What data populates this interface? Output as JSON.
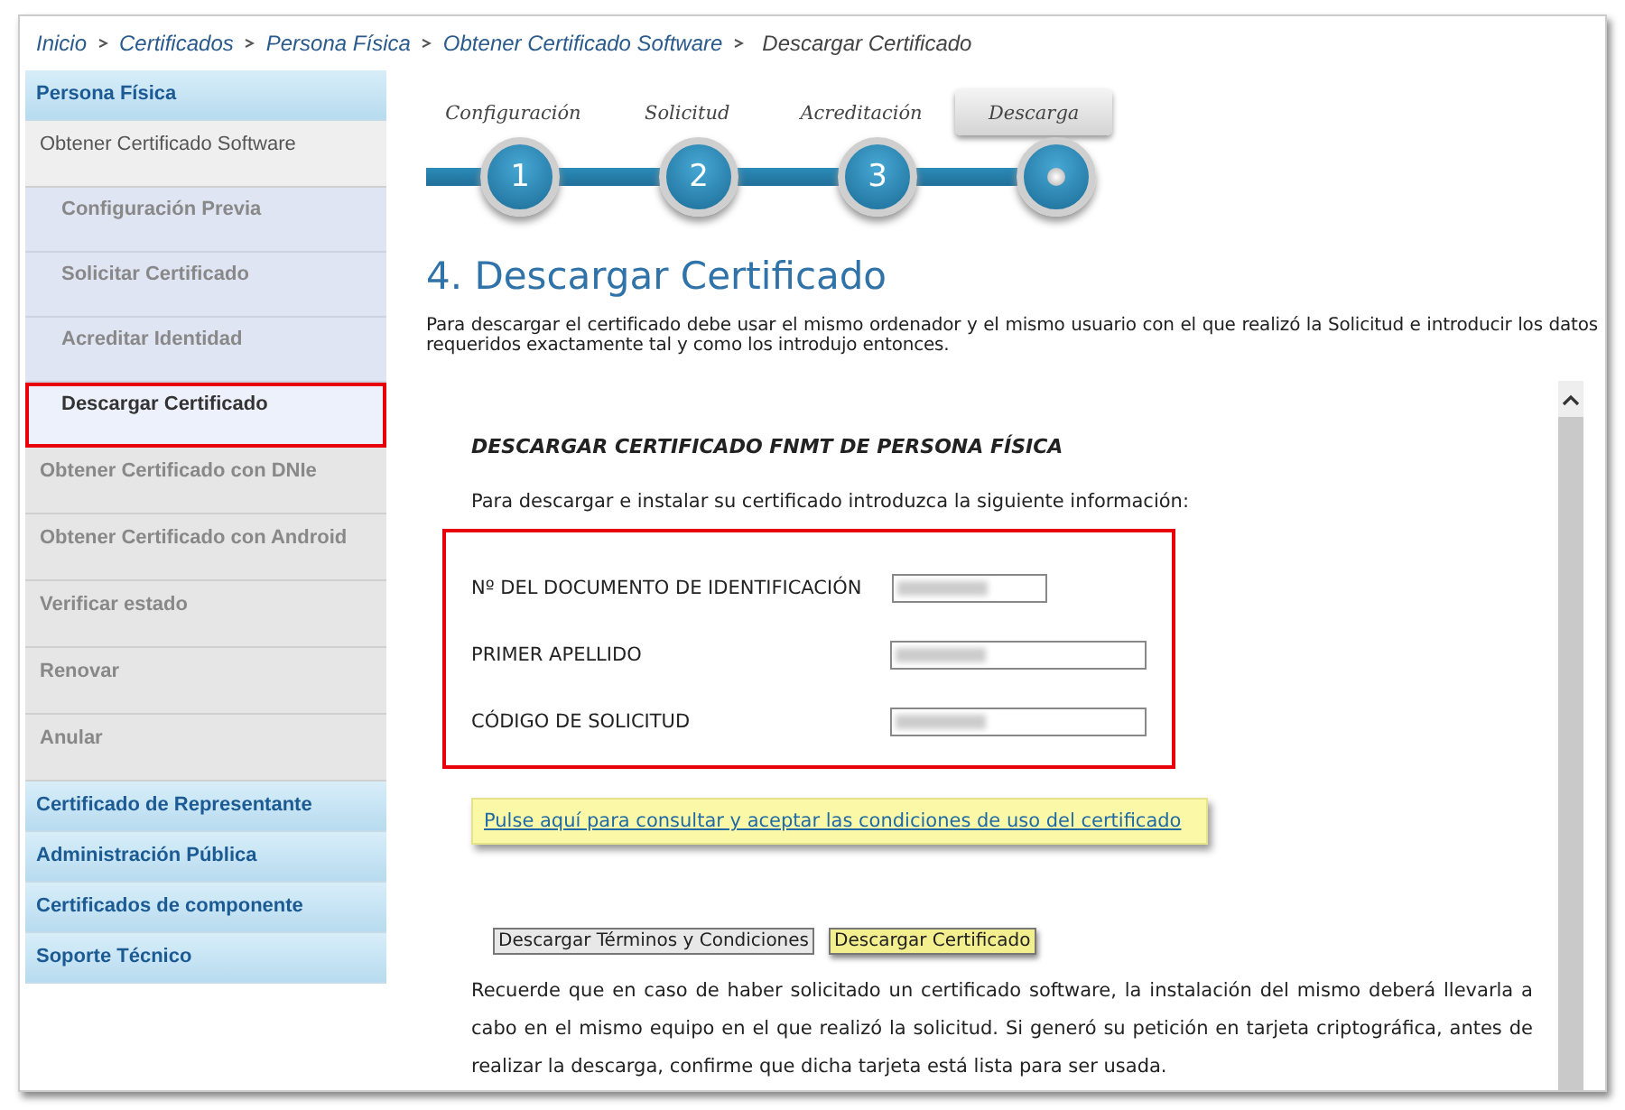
{
  "breadcrumb": [
    "Inicio",
    "Certificados",
    "Persona Física",
    "Obtener Certificado Software",
    "Descargar Certificado"
  ],
  "sidebar": {
    "items": [
      {
        "kind": "section",
        "label": "Persona Física",
        "selected": false,
        "highlighted": false
      },
      {
        "kind": "item",
        "label": "Obtener Certificado Software",
        "selected": false,
        "highlighted": false,
        "children": [
          {
            "kind": "subitem",
            "label": "Configuración Previa",
            "selected": false,
            "highlighted": false
          },
          {
            "kind": "subitem",
            "label": "Solicitar Certificado",
            "selected": false,
            "highlighted": false
          },
          {
            "kind": "subitem",
            "label": "Acreditar Identidad",
            "selected": false,
            "highlighted": false
          },
          {
            "kind": "subitem",
            "label": "Descargar Certificado",
            "selected": true,
            "highlighted": true
          }
        ]
      },
      {
        "kind": "item",
        "label": "Obtener Certificado con DNIe",
        "selected": false,
        "highlighted": false
      },
      {
        "kind": "item",
        "label": "Obtener Certificado con Android",
        "selected": false,
        "highlighted": false
      },
      {
        "kind": "item",
        "label": "Verificar estado",
        "selected": false,
        "highlighted": false
      },
      {
        "kind": "item",
        "label": "Renovar",
        "selected": false,
        "highlighted": false
      },
      {
        "kind": "item",
        "label": "Anular",
        "selected": false,
        "highlighted": false
      },
      {
        "kind": "section",
        "label": "Certificado de Representante",
        "selected": false,
        "highlighted": false
      },
      {
        "kind": "section",
        "label": "Administración Pública",
        "selected": false,
        "highlighted": false
      },
      {
        "kind": "section",
        "label": "Certificados de componente",
        "selected": false,
        "highlighted": false
      },
      {
        "kind": "section",
        "label": "Soporte Técnico",
        "selected": false,
        "highlighted": false
      }
    ]
  },
  "steps": [
    {
      "label": "Configuración",
      "number": "1",
      "selected": false
    },
    {
      "label": "Solicitud",
      "number": "2",
      "selected": false
    },
    {
      "label": "Acreditación",
      "number": "3",
      "selected": false
    },
    {
      "label": "Descarga",
      "selected": true
    }
  ],
  "title": "4. Descargar Certificado",
  "intro": "Para descargar el certificado debe usar el mismo ordenador y el mismo usuario con el que realizó la Solicitud e introducir los datos requeridos exactamente tal y como los introdujo entonces.",
  "form": {
    "title": "DESCARGAR CERTIFICADO FNMT DE PERSONA FÍSICA",
    "instructions": "Para descargar e instalar su certificado introduzca la siguiente información:",
    "highlighted": true,
    "fields": [
      {
        "label": "Nº DEL DOCUMENTO DE IDENTIFICACIÓN",
        "kind": "short"
      },
      {
        "label": "PRIMER APELLIDO",
        "kind": "long"
      },
      {
        "label": "CÓDIGO DE SOLICITUD",
        "kind": "long"
      }
    ],
    "conditions_link": "Pulse aquí para consultar y aceptar las condiciones de uso del certificado",
    "buttons": [
      {
        "label": "Descargar Términos y Condiciones",
        "highlighted": false
      },
      {
        "label": "Descargar Certificado",
        "highlighted": true
      }
    ],
    "note": "Recuerde que en caso de haber solicitado un certificado software, la instalación del mismo deberá llevarla a cabo en el mismo equipo en el que realizó la solicitud. Si generó su petición en tarjeta criptográfica, antes de realizar la descarga, confirme que dicha tarjeta está lista para ser usada."
  }
}
